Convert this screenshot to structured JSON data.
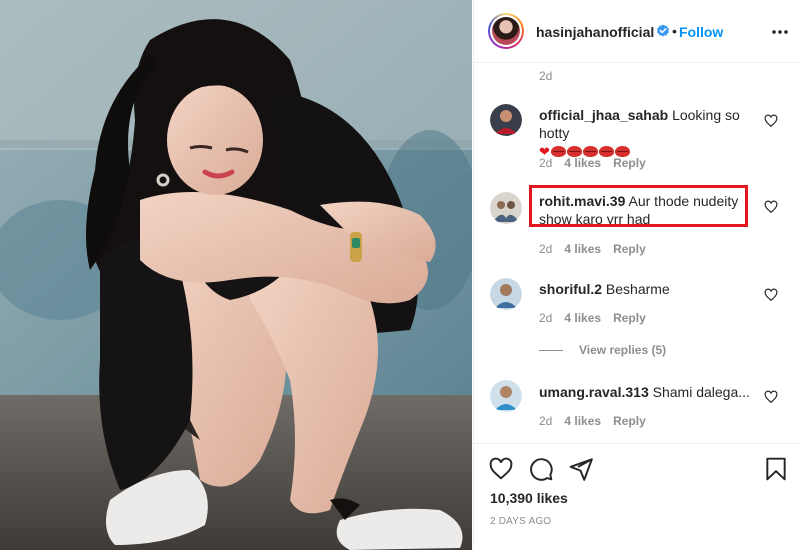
{
  "post": {
    "username": "hasinjahanofficial",
    "separator": "•",
    "follow_label": "Follow",
    "verified_icon": "verified-badge-icon",
    "more_icon": "more-options-icon",
    "accent_color": "#0095f6",
    "highlight_color": "#e0171f"
  },
  "comments_section": {
    "previous_comment_time": "2d",
    "comments": [
      {
        "username": "official_jhaa_sahab",
        "text": "Looking so hotty",
        "emojis": [
          "heart",
          "kiss",
          "kiss",
          "kiss",
          "kiss",
          "kiss"
        ],
        "time": "2d",
        "likes": "4 likes",
        "reply": "Reply"
      },
      {
        "username": "rohit.mavi.39",
        "text": "Aur thode nudeity show karo yrr had",
        "time": "2d",
        "likes": "4 likes",
        "reply": "Reply",
        "highlighted": true
      },
      {
        "username": "shoriful.2",
        "text": "Besharme",
        "time": "2d",
        "likes": "4 likes",
        "reply": "Reply",
        "view_replies": "View replies (5)"
      },
      {
        "username": "umang.raval.313",
        "text": "Shami dalega...",
        "time": "2d",
        "likes": "4 likes",
        "reply": "Reply"
      }
    ]
  },
  "actions": {
    "icons": [
      "heart-icon",
      "comment-icon",
      "share-icon",
      "bookmark-icon"
    ],
    "likes": "10,390 likes",
    "date": "2 DAYS AGO"
  }
}
